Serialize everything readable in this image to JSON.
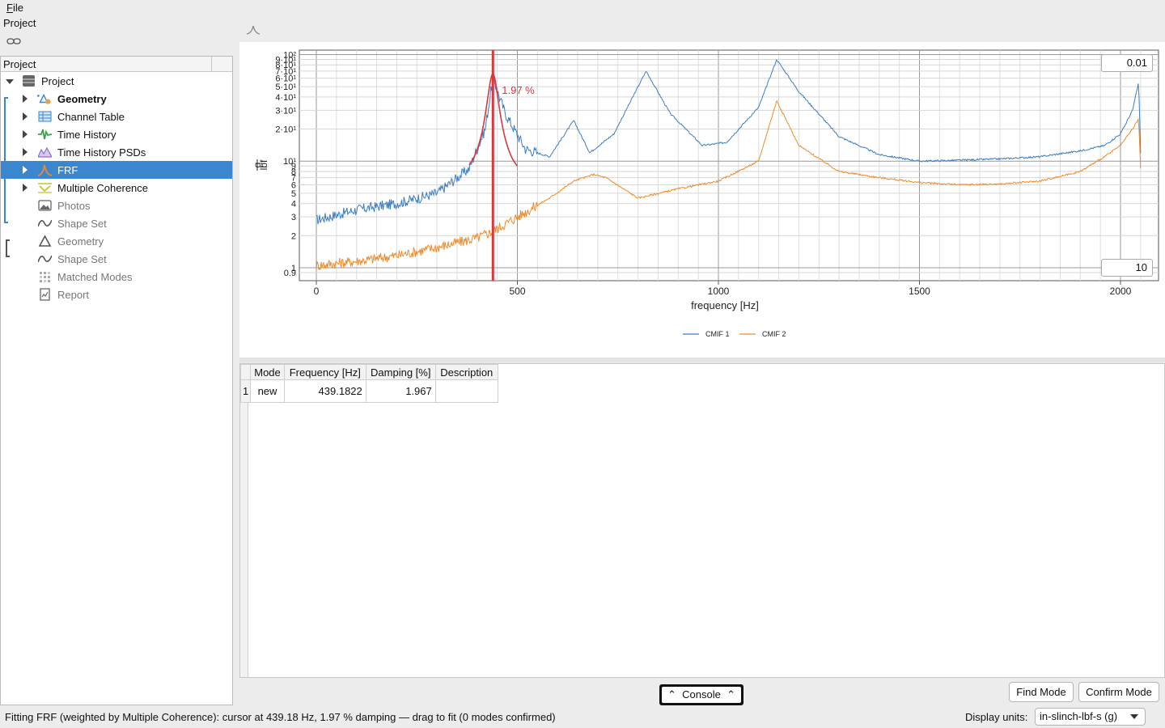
{
  "menubar": {
    "file": "File"
  },
  "project_label": "Project",
  "tree": {
    "header": "Project",
    "items": [
      {
        "label": "Project",
        "icon": "database-icon",
        "bold": false,
        "dim": false,
        "expanded": true
      },
      {
        "label": "Geometry",
        "icon": "geometry-warning-icon",
        "bold": true,
        "dim": false
      },
      {
        "label": "Channel Table",
        "icon": "table-icon",
        "bold": false,
        "dim": false
      },
      {
        "label": "Time History",
        "icon": "signal-icon",
        "bold": false,
        "dim": false
      },
      {
        "label": "Time History PSDs",
        "icon": "psd-icon",
        "bold": false,
        "dim": false
      },
      {
        "label": "FRF",
        "icon": "frf-icon",
        "bold": false,
        "dim": false,
        "selected": true
      },
      {
        "label": "Multiple Coherence",
        "icon": "coherence-icon",
        "bold": false,
        "dim": false
      },
      {
        "label": "Photos",
        "icon": "photo-icon",
        "dim": true
      },
      {
        "label": "Shape Set",
        "icon": "shape-wave-icon",
        "dim": true
      },
      {
        "label": "Geometry",
        "icon": "geometry-icon",
        "dim": true
      },
      {
        "label": "Shape Set",
        "icon": "shape-wave-icon",
        "dim": true
      },
      {
        "label": "Matched Modes",
        "icon": "grid-icon",
        "dim": true
      },
      {
        "label": "Report",
        "icon": "report-icon",
        "dim": true
      }
    ]
  },
  "chart_data": {
    "type": "line",
    "title": "",
    "xlabel": "frequency [Hz]",
    "ylabel": "g / lbf",
    "xlim": [
      0,
      2060
    ],
    "ylim": [
      0.9,
      110
    ],
    "y_scale": "log",
    "grid": true,
    "x_ticks": [
      "0",
      "500",
      "1000",
      "1500",
      "2000"
    ],
    "y_ticks": [
      "0.9",
      "1",
      "2",
      "3",
      "4",
      "5",
      "6",
      "7",
      "8",
      "9",
      "10¹",
      "2·10¹",
      "3·10¹",
      "4·10¹",
      "5·10¹",
      "6·10¹",
      "7·10¹",
      "8·10¹",
      "9·10¹",
      "10²"
    ],
    "legend_placement": "bottom-center",
    "cursor": {
      "x": 439.18,
      "label": "1.97 %",
      "color": "#d9363e"
    },
    "series": [
      {
        "name": "CMIF 1",
        "color": "#3b7dc3",
        "x": [
          0,
          100,
          200,
          300,
          380,
          420,
          439,
          470,
          520,
          580,
          640,
          680,
          740,
          820,
          880,
          960,
          1020,
          1100,
          1145,
          1200,
          1300,
          1400,
          1500,
          1600,
          1700,
          1800,
          1900,
          1960,
          2000,
          2030,
          2045,
          2050
        ],
        "values": [
          2.8,
          3.5,
          4.0,
          5.0,
          8.5,
          20,
          60,
          28,
          13,
          11,
          24,
          12,
          18,
          70,
          28,
          14,
          15,
          32,
          90,
          45,
          17,
          11.5,
          10,
          10.2,
          10.5,
          11,
          12.5,
          14,
          18,
          30,
          55,
          12
        ]
      },
      {
        "name": "CMIF 2",
        "color": "#ef8a2c",
        "x": [
          0,
          100,
          200,
          300,
          400,
          439,
          500,
          580,
          640,
          690,
          720,
          800,
          900,
          1000,
          1100,
          1145,
          1200,
          1300,
          1400,
          1500,
          1600,
          1700,
          1800,
          1900,
          1960,
          2000,
          2030,
          2045,
          2050
        ],
        "values": [
          1.05,
          1.15,
          1.3,
          1.55,
          1.9,
          2.2,
          3.0,
          4.5,
          6.5,
          7.5,
          7.0,
          4.5,
          5.5,
          6.5,
          10,
          37,
          14,
          8.0,
          7.0,
          6.3,
          6.0,
          6.1,
          6.5,
          8.0,
          11,
          14,
          20,
          25,
          8.5
        ]
      }
    ]
  },
  "axis_inputs": {
    "y_min": "10",
    "y_max": "0.01"
  },
  "modes_table": {
    "columns": [
      "Mode",
      "Frequency [Hz]",
      "Damping [%]",
      "Description"
    ],
    "rows": [
      {
        "index": "1",
        "mode": "new",
        "frequency": "439.1822",
        "damping": "1.967",
        "description": ""
      }
    ]
  },
  "console_label": "Console",
  "buttons": {
    "find_mode": "Find Mode",
    "confirm_mode": "Confirm Mode"
  },
  "status": "Fitting FRF (weighted by Multiple Coherence): cursor at 439.18 Hz, 1.97 % damping — drag to fit (0 modes confirmed)",
  "units": {
    "label": "Display units:",
    "value": "in-slinch-lbf-s (g)"
  }
}
